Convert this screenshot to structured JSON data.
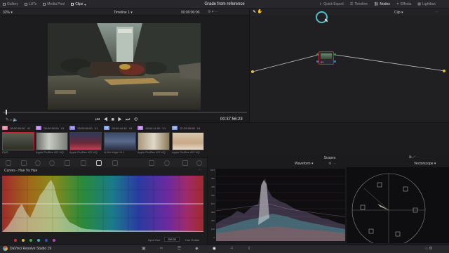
{
  "topbar": {
    "tabs": [
      {
        "label": "Gallery"
      },
      {
        "label": "LUTs"
      },
      {
        "label": "Media Pool"
      },
      {
        "label": "Clips"
      }
    ],
    "title": "Grade from reference",
    "right_tabs": [
      {
        "label": "Quick Export"
      },
      {
        "label": "Timeline"
      },
      {
        "label": "Nodes"
      },
      {
        "label": "Effects"
      },
      {
        "label": "Lightbox"
      }
    ]
  },
  "viewer": {
    "zoom": "32%",
    "timeline_name": "Timeline 1",
    "timecode_top": "00:00:00:00",
    "timecode_current": "00:37:56:23"
  },
  "nodes": {
    "mode": "Clip",
    "node_label": "01"
  },
  "clips": [
    {
      "index": "01",
      "timecode": "00:00:00:00",
      "track": "V1",
      "label": "PNG",
      "color": "#ee7fa0"
    },
    {
      "index": "02",
      "timecode": "00:00:00:00",
      "track": "V1",
      "label": "Apple ProRes 422 HQ",
      "color": "#b57fe6"
    },
    {
      "index": "03",
      "timecode": "00:00:00:00",
      "track": "V1",
      "label": "Apple ProRes 422 HQ",
      "color": "#8a7fe6"
    },
    {
      "index": "04",
      "timecode": "00:00:44:15",
      "track": "V1",
      "label": "H.264 High L5.1",
      "color": "#7f9ee6"
    },
    {
      "index": "05",
      "timecode": "00:04:11:00",
      "track": "V1",
      "label": "Apple ProRes 422 HQ",
      "color": "#b57fe6"
    },
    {
      "index": "06",
      "timecode": "21:29:09:08",
      "track": "V1",
      "label": "Apple ProRes 422 HQ",
      "color": "#7f9ee6"
    }
  ],
  "curves": {
    "title": "Curves - Hue Vs Hue",
    "input_label": "Input Hue",
    "input_value": "256.00",
    "output_label": "Hue Rotate",
    "output_value": "0.00"
  },
  "scopes": {
    "title": "Scopes",
    "waveform_label": "Waveform",
    "vectorscope_label": "Vectorscope",
    "waveform_scale": [
      "1023",
      "896",
      "768",
      "640",
      "512",
      "384",
      "256",
      "128",
      "0"
    ]
  },
  "statusbar": {
    "app_name": "DaVinci Resolve Studio 19"
  },
  "colors": {
    "accent_red": "#c0283a",
    "node_orange": "#e0a24a",
    "node_green": "#3aa04a"
  }
}
